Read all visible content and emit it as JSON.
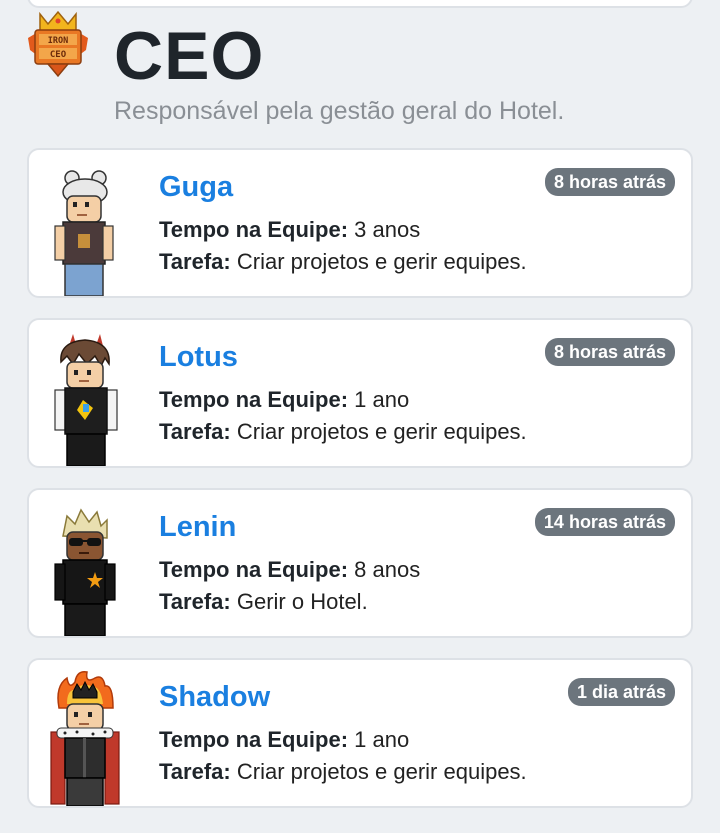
{
  "role": {
    "badge_text_line1": "IRON",
    "badge_text_line2": "CEO",
    "title": "CEO",
    "description": "Responsável pela gestão geral do Hotel."
  },
  "labels": {
    "time_label": "Tempo na Equipe:",
    "task_label": "Tarefa:"
  },
  "members": [
    {
      "name": "Guga",
      "last_seen": "8 horas atrás",
      "time_in_team": "3 anos",
      "task": "Criar projetos e gerir equipes."
    },
    {
      "name": "Lotus",
      "last_seen": "8 horas atrás",
      "time_in_team": "1 ano",
      "task": "Criar projetos e gerir equipes."
    },
    {
      "name": "Lenin",
      "last_seen": "14 horas atrás",
      "time_in_team": "8 anos",
      "task": "Gerir o Hotel."
    },
    {
      "name": "Shadow",
      "last_seen": "1 dia atrás",
      "time_in_team": "1 ano",
      "task": "Criar projetos e gerir equipes."
    }
  ],
  "colors": {
    "name": "#1a7fe0",
    "badge_bg": "#6c757d",
    "page_bg": "#edf0f3"
  }
}
